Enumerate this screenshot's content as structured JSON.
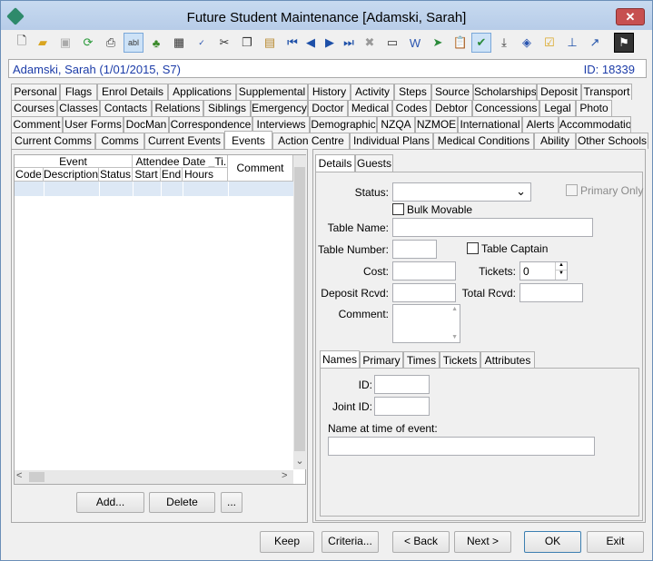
{
  "window": {
    "title": "Future Student Maintenance  [Adamski, Sarah]",
    "close_glyph": "✕"
  },
  "toolbar": {
    "icons": [
      "new-icon",
      "open-icon",
      "save-icon",
      "refresh-icon",
      "print-icon",
      "text-field-icon",
      "tree-icon",
      "calculator-icon",
      "spellcheck-icon",
      "cut-icon",
      "copy-icon",
      "paste-icon",
      "first-record-icon",
      "previous-record-icon",
      "next-record-icon",
      "last-record-icon",
      "delete-icon",
      "card-icon",
      "word-icon",
      "send-icon",
      "clipboard-icon",
      "approve-icon",
      "download-icon",
      "tag-icon",
      "checklist-icon",
      "pin-icon",
      "arrow-icon",
      "flag-icon"
    ]
  },
  "header": {
    "name": "Adamski, Sarah (1/01/2015, S7)",
    "id": "ID: 18339"
  },
  "tabs": {
    "row1": [
      "Personal",
      "Flags",
      "Enrol Details",
      "Applications",
      "Supplemental",
      "History",
      "Activity",
      "Steps",
      "Source",
      "Scholarships",
      "Deposit",
      "Transport"
    ],
    "row2": [
      "Courses",
      "Classes",
      "Contacts",
      "Relations",
      "Siblings",
      "Emergency",
      "Doctor",
      "Medical",
      "Codes",
      "Debtor",
      "Concessions",
      "Legal",
      "Photo"
    ],
    "row3": [
      "Comment",
      "User Forms",
      "DocMan",
      "Correspondence",
      "Interviews",
      "Demographic",
      "NZQA",
      "NZMOE",
      "International",
      "Alerts",
      "Accommodation"
    ],
    "row4": [
      "Current Comms",
      "Comms",
      "Current Events",
      "Events",
      "Action Centre",
      "Individual Plans",
      "Medical Conditions",
      "Ability",
      "Other Schools"
    ],
    "active": "Events"
  },
  "grid": {
    "group_event": "Event",
    "group_attendee": "Attendee",
    "group_date": "Date _Ti...",
    "comment": "Comment",
    "columns": [
      "Code",
      "Description",
      "Status",
      "Start",
      "End",
      "Hours"
    ],
    "scroll_down": "⌄",
    "scroll_left": "<",
    "scroll_right": ">"
  },
  "left_buttons": {
    "add": "Add...",
    "delete": "Delete",
    "more": "..."
  },
  "detail_tabs": {
    "details": "Details",
    "guests": "Guests"
  },
  "details": {
    "status_label": "Status:",
    "status_value": "",
    "dropdown_glyph": "⌄",
    "primary_only": "Primary Only",
    "bulk_movable": "Bulk Movable",
    "table_name_label": "Table Name:",
    "table_number_label": "Table Number:",
    "table_captain": "Table Captain",
    "cost_label": "Cost:",
    "tickets_label": "Tickets:",
    "tickets_value": "0",
    "deposit_label": "Deposit Rcvd:",
    "total_label": "Total Rcvd:",
    "comment_label": "Comment:"
  },
  "names_tabs": [
    "Names",
    "Primary",
    "Times",
    "Tickets",
    "Attributes"
  ],
  "names": {
    "id_label": "ID:",
    "joint_id_label": "Joint ID:",
    "name_at_event_label": "Name at time of event:"
  },
  "bottom_buttons": {
    "keep": "Keep",
    "criteria": "Criteria...",
    "back": "< Back",
    "next": "Next >",
    "ok": "OK",
    "exit": "Exit"
  }
}
